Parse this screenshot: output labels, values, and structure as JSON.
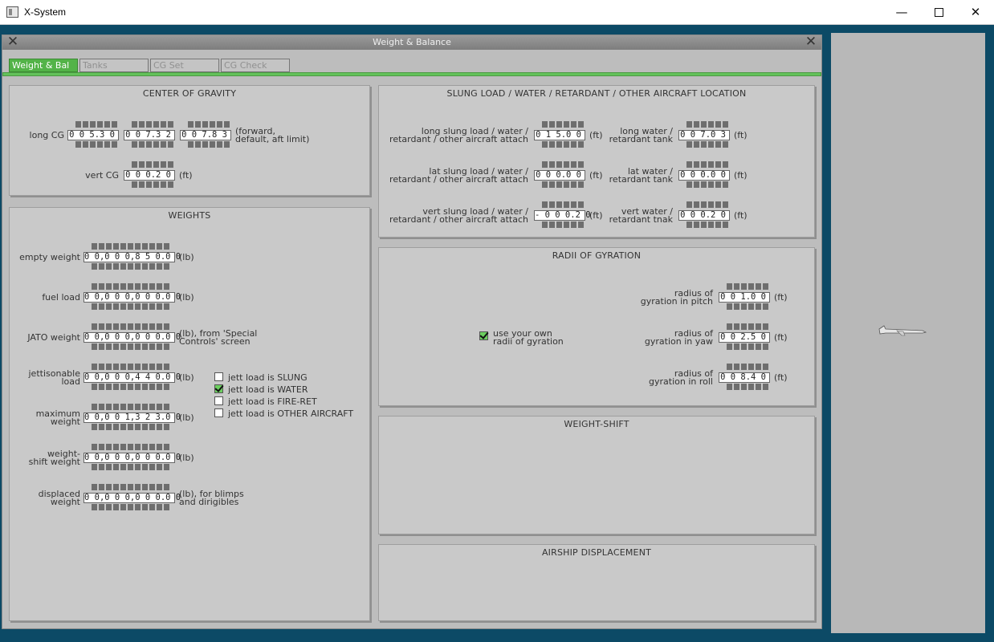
{
  "window": {
    "title": "X-System",
    "minimize": "—",
    "close": "✕"
  },
  "dialog": {
    "title": "Weight & Balance"
  },
  "tabs": [
    "Weight & Bal",
    "Tanks",
    "CG Set",
    "CG Check"
  ],
  "cg": {
    "title": "CENTER OF GRAVITY",
    "long_label": "long CG",
    "long_values": [
      "0 0 5.3 0",
      "0 0 7.3 2",
      "0 0 7.8 3"
    ],
    "long_unit_1": "(forward,",
    "long_unit_2": "default, aft limit)",
    "vert_label": "vert CG",
    "vert_value": "0 0 0.2 0",
    "unit_ft": "(ft)"
  },
  "weights": {
    "title": "WEIGHTS",
    "unit_lb": "(lb)",
    "empty": {
      "label": "empty weight",
      "value": "0 0,0 0 0,8 5 0.0 0"
    },
    "fuel": {
      "label": "fuel load",
      "value": "0 0,0 0 0,0 0 0.0 0"
    },
    "jato": {
      "label": "JATO weight",
      "value": "0 0,0 0 0,0 0 0.0 0",
      "unit_1": "(lb), from 'Special",
      "unit_2": "Controls' screen"
    },
    "jett": {
      "label_1": "jettisonable",
      "label_2": "load",
      "value": "0 0,0 0 0,4 4 0.0 0"
    },
    "max": {
      "label_1": "maximum",
      "label_2": "weight",
      "value": "0 0,0 0 1,3 2 3.0 0"
    },
    "shift": {
      "label_1": "weight-",
      "label_2": "shift weight",
      "value": "0 0,0 0 0,0 0 0.0 0"
    },
    "displaced": {
      "label_1": "displaced",
      "label_2": "weight",
      "value": "0 0,0 0 0,0 0 0.0 0",
      "unit_1": "(lb), for blimps",
      "unit_2": "and dirigibles"
    },
    "jett_options": [
      {
        "label": "jett load is SLUNG",
        "checked": false
      },
      {
        "label": "jett load is WATER",
        "checked": true
      },
      {
        "label": "jett load is FIRE-RET",
        "checked": false
      },
      {
        "label": "jett load is OTHER AIRCRAFT",
        "checked": false
      }
    ]
  },
  "slung": {
    "title": "SLUNG LOAD / WATER / RETARDANT / OTHER AIRCRAFT LOCATION",
    "unit_ft": "(ft)",
    "long_attach": {
      "label_1": "long slung load / water /",
      "label_2": "retardant / other aircraft attach",
      "value": "0 1 5.0 0"
    },
    "lat_attach": {
      "label_1": "lat  slung load / water /",
      "label_2": "retardant / other aircraft attach",
      "value": "0 0 0.0 0"
    },
    "vert_attach": {
      "label_1": "vert slung load / water /",
      "label_2": "retardant / other aircraft attach",
      "value": "- 0 0 0.2 0"
    },
    "long_tank": {
      "label_1": "long water /",
      "label_2": "retardant tank",
      "value": "0 0 7.0 3"
    },
    "lat_tank": {
      "label_1": "lat  water /",
      "label_2": "retardant tank",
      "value": "0 0 0.0 0"
    },
    "vert_tank": {
      "label_1": "vert water /",
      "label_2": "retardant tnak",
      "value": "0 0 0.2 0"
    }
  },
  "gyration": {
    "title": "RADII OF GYRATION",
    "use_own_1": "use your own",
    "use_own_2": "radii of gyration",
    "use_own_checked": true,
    "unit_ft": "(ft)",
    "pitch": {
      "label_1": "radius of",
      "label_2": "gyration in pitch",
      "value": "0 0 1.0 0"
    },
    "yaw": {
      "label_1": "radius of",
      "label_2": "gyration in yaw",
      "value": "0 0 2.5 0"
    },
    "roll": {
      "label_1": "radius of",
      "label_2": "gyration in roll",
      "value": "0 0 8.4 0"
    }
  },
  "weight_shift": {
    "title": "WEIGHT-SHIFT"
  },
  "airship": {
    "title": "AIRSHIP DISPLACEMENT"
  }
}
